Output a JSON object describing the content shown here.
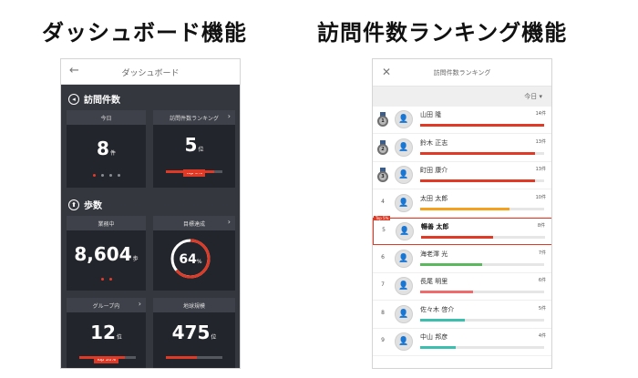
{
  "headings": {
    "dashboard": "ダッシュボード機能",
    "ranking": "訪問件数ランキング機能"
  },
  "dashboard": {
    "title": "ダッシュボード",
    "visits_section": "訪問件数",
    "steps_section": "歩数",
    "cards": {
      "today": {
        "label": "今日",
        "value": "8",
        "unit": "件"
      },
      "ranking": {
        "label": "訪問件数ランキング",
        "value": "5",
        "unit": "位",
        "badge": "Top 5%",
        "progress": 0.85
      },
      "working": {
        "label": "業務中",
        "value": "8,604",
        "unit": "歩"
      },
      "goal": {
        "label": "目標達成",
        "value": "64",
        "unit": "%",
        "progress": 0.64
      },
      "group": {
        "label": "グループ内",
        "value": "12",
        "unit": "位",
        "badge": "Top 20%",
        "progress": 0.8
      },
      "global": {
        "label": "地球規模",
        "value": "475",
        "unit": "位",
        "progress": 0.55
      }
    }
  },
  "ranking": {
    "title": "訪問件数ランキング",
    "filter": "今日 ▾",
    "highlight_badge": "Top 5%",
    "rows": [
      {
        "rank": "1",
        "name": "山田 隆",
        "count": "14件",
        "ratio": 1.0,
        "color": "#e03a26"
      },
      {
        "rank": "2",
        "name": "鈴木 正志",
        "count": "13件",
        "ratio": 0.93,
        "color": "#e03a26"
      },
      {
        "rank": "3",
        "name": "町田 康介",
        "count": "13件",
        "ratio": 0.93,
        "color": "#e03a26"
      },
      {
        "rank": "4",
        "name": "太田 太郎",
        "count": "10件",
        "ratio": 0.72,
        "color": "#f4a21e"
      },
      {
        "rank": "5",
        "name": "暢善 太郎",
        "count": "8件",
        "ratio": 0.58,
        "color": "#e03a26"
      },
      {
        "rank": "6",
        "name": "海老澤 光",
        "count": "7件",
        "ratio": 0.5,
        "color": "#5cb85c"
      },
      {
        "rank": "7",
        "name": "長尾 明里",
        "count": "6件",
        "ratio": 0.43,
        "color": "#f06b6b"
      },
      {
        "rank": "8",
        "name": "佐々木 啓介",
        "count": "5件",
        "ratio": 0.36,
        "color": "#3dbfb0"
      },
      {
        "rank": "9",
        "name": "中山 邦彦",
        "count": "4件",
        "ratio": 0.29,
        "color": "#3dbfb0"
      }
    ]
  }
}
